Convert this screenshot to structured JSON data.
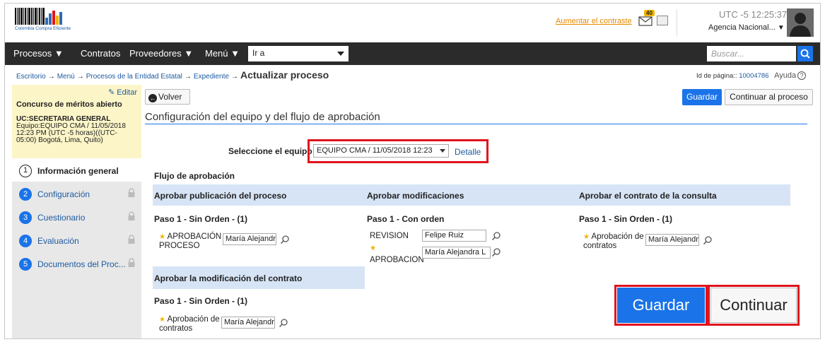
{
  "header": {
    "logo_caption": "Colombia Compra Eficiente",
    "contrast_link": "Aumentar el contraste",
    "mail_count": "40",
    "utc_label": "UTC -5",
    "time": "12:25:37",
    "agency": "Agencia Nacional..."
  },
  "nav": {
    "items": [
      "Procesos",
      "Contratos",
      "Proveedores",
      "Menú"
    ],
    "goto_label": "Ir a",
    "search_placeholder": "Buscar..."
  },
  "breadcrumb": {
    "items": [
      "Escritorio",
      "Menú",
      "Procesos de la Entidad Estatal",
      "Expediente"
    ],
    "current": "Actualizar proceso",
    "page_id_label": "Id de página::",
    "page_id": "10004786",
    "help": "Ayuda"
  },
  "sidebar": {
    "edit": "Editar",
    "title": "Concurso de méritos abierto",
    "uc": "UC:SECRETARIA GENERAL",
    "equipo": "Equipo:EQUIPO CMA / 11/05/2018 12:23 PM (UTC -5 horas)((UTC-05:00) Bogotá, Lima, Quito)",
    "steps": [
      {
        "num": "1",
        "label": "Información general"
      },
      {
        "num": "2",
        "label": "Configuración"
      },
      {
        "num": "3",
        "label": "Cuestionario"
      },
      {
        "num": "4",
        "label": "Evaluación"
      },
      {
        "num": "5",
        "label": "Documentos del Proc..."
      }
    ]
  },
  "main": {
    "back": "Volver",
    "save": "Guardar",
    "continue_process": "Continuar al proceso",
    "section_title": "Configuración del equipo y del flujo de aprobación",
    "select_label": "Seleccione el equipo",
    "select_value": "EQUIPO CMA / 11/05/2018 12:23",
    "detail": "Detalle",
    "flow_title": "Flujo de aprobación",
    "columns": [
      {
        "heading": "Aprobar publicación del proceso",
        "step": "Paso 1 - Sin Orden - (1)"
      },
      {
        "heading": "Aprobar modificaciones",
        "step": "Paso 1 - Con orden"
      },
      {
        "heading": "Aprobar el contrato de la consulta",
        "step": "Paso 1 - Sin Orden - (1)"
      },
      {
        "heading": "Aprobar la modificación del contrato",
        "step": "Paso 1 - Sin Orden - (1)"
      }
    ],
    "roles": {
      "aprobacion_proceso": "APROBACIÓN PROCESO",
      "revision": "REVISION",
      "aprobacion": "APROBACION",
      "aprobacion_contratos": "Aprobación de contratos"
    },
    "people": {
      "maria": "María Alejandra",
      "maria_l": "María Alejandra L",
      "felipe": "Felipe Ruiz"
    },
    "big_save": "Guardar",
    "big_continue": "Continuar"
  }
}
